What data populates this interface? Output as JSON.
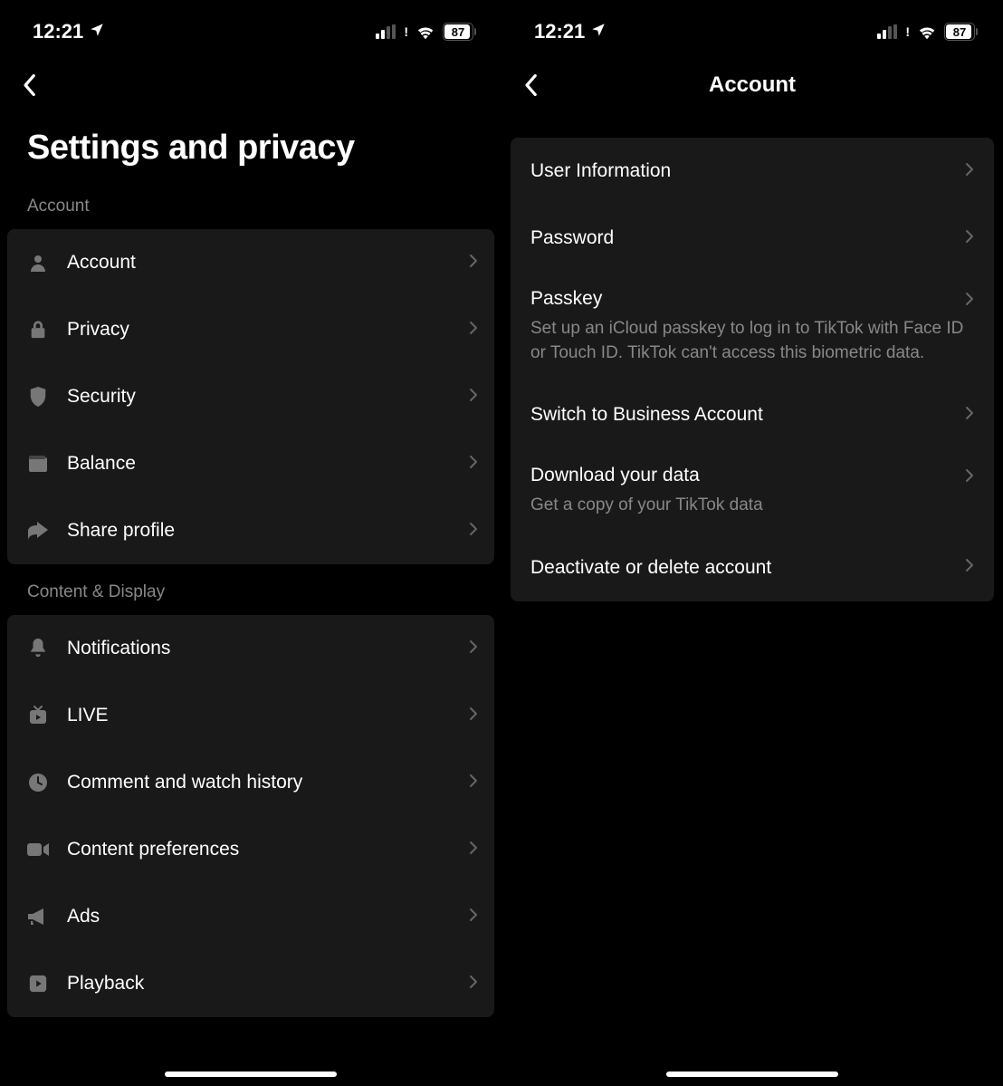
{
  "status": {
    "time": "12:21",
    "battery": "87"
  },
  "left": {
    "page_title": "Settings and privacy",
    "sections": [
      {
        "header": "Account",
        "items": [
          {
            "label": "Account"
          },
          {
            "label": "Privacy"
          },
          {
            "label": "Security"
          },
          {
            "label": "Balance"
          },
          {
            "label": "Share profile"
          }
        ]
      },
      {
        "header": "Content & Display",
        "items": [
          {
            "label": "Notifications"
          },
          {
            "label": "LIVE"
          },
          {
            "label": "Comment and watch history"
          },
          {
            "label": "Content preferences"
          },
          {
            "label": "Ads"
          },
          {
            "label": "Playback"
          }
        ]
      }
    ]
  },
  "right": {
    "nav_title": "Account",
    "items": [
      {
        "label": "User Information"
      },
      {
        "label": "Password"
      },
      {
        "label": "Passkey",
        "desc": "Set up an iCloud passkey to log in to TikTok with Face ID or Touch ID. TikTok can't access this biometric data."
      },
      {
        "label": "Switch to Business Account"
      },
      {
        "label": "Download your data",
        "desc": "Get a copy of your TikTok data"
      },
      {
        "label": "Deactivate or delete account"
      }
    ]
  }
}
